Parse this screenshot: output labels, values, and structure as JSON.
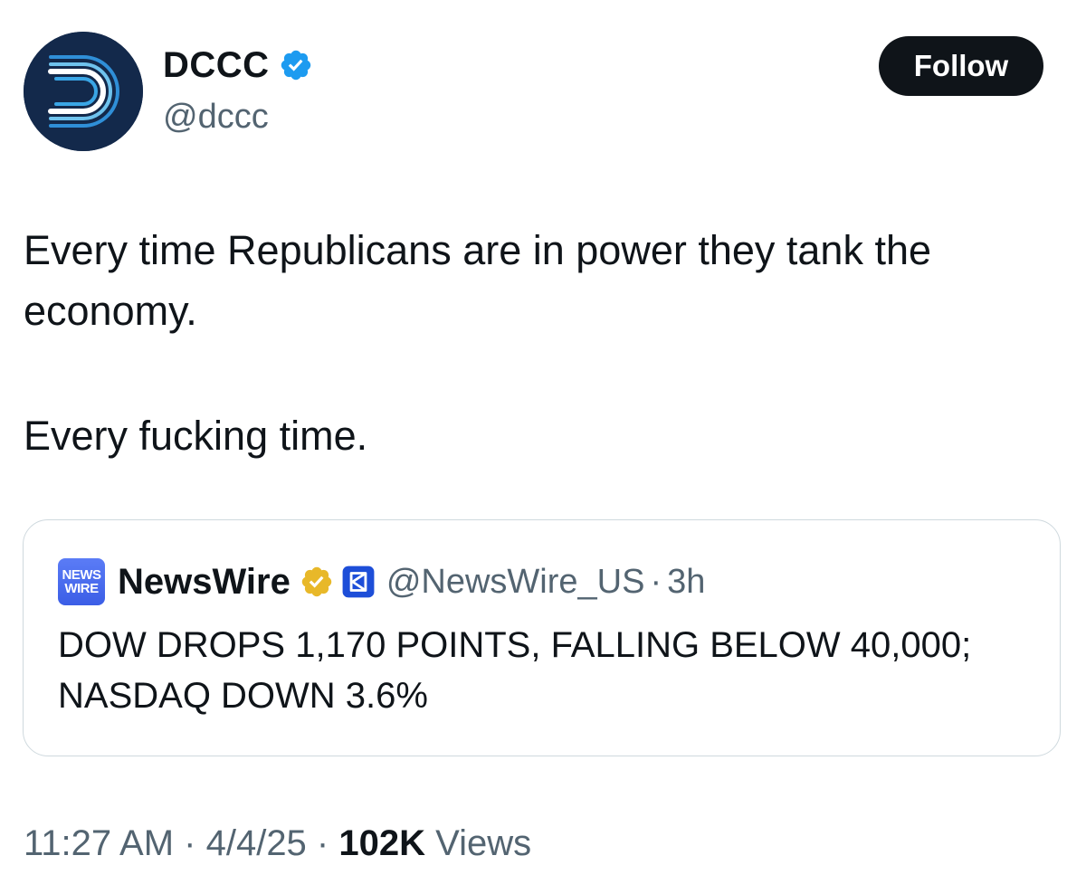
{
  "author": {
    "display_name": "DCCC",
    "handle": "@dccc",
    "verified_icon": "verified-badge-icon",
    "verified_color": "#1d9bf0",
    "avatar_bg": "#13294b"
  },
  "follow_button": {
    "label": "Follow"
  },
  "tweet": {
    "paragraph1": "Every time Republicans are in power they tank the economy.",
    "paragraph2": "Every fucking time."
  },
  "quoted_tweet": {
    "avatar_text_line1": "NEWS",
    "avatar_text_line2": "WIRE",
    "display_name": "NewsWire",
    "verified_icon": "gold-verified-badge-icon",
    "verified_color": "#e8b829",
    "affiliate_icon": "affiliate-logo-icon",
    "handle": "@NewsWire_US",
    "separator": "·",
    "time": "3h",
    "text": "DOW DROPS 1,170 POINTS, FALLING BELOW 40,000; NASDAQ DOWN 3.6%"
  },
  "meta": {
    "time": "11:27 AM",
    "date": "4/4/25",
    "separator": " · ",
    "views_count": "102K",
    "views_label": "Views"
  }
}
